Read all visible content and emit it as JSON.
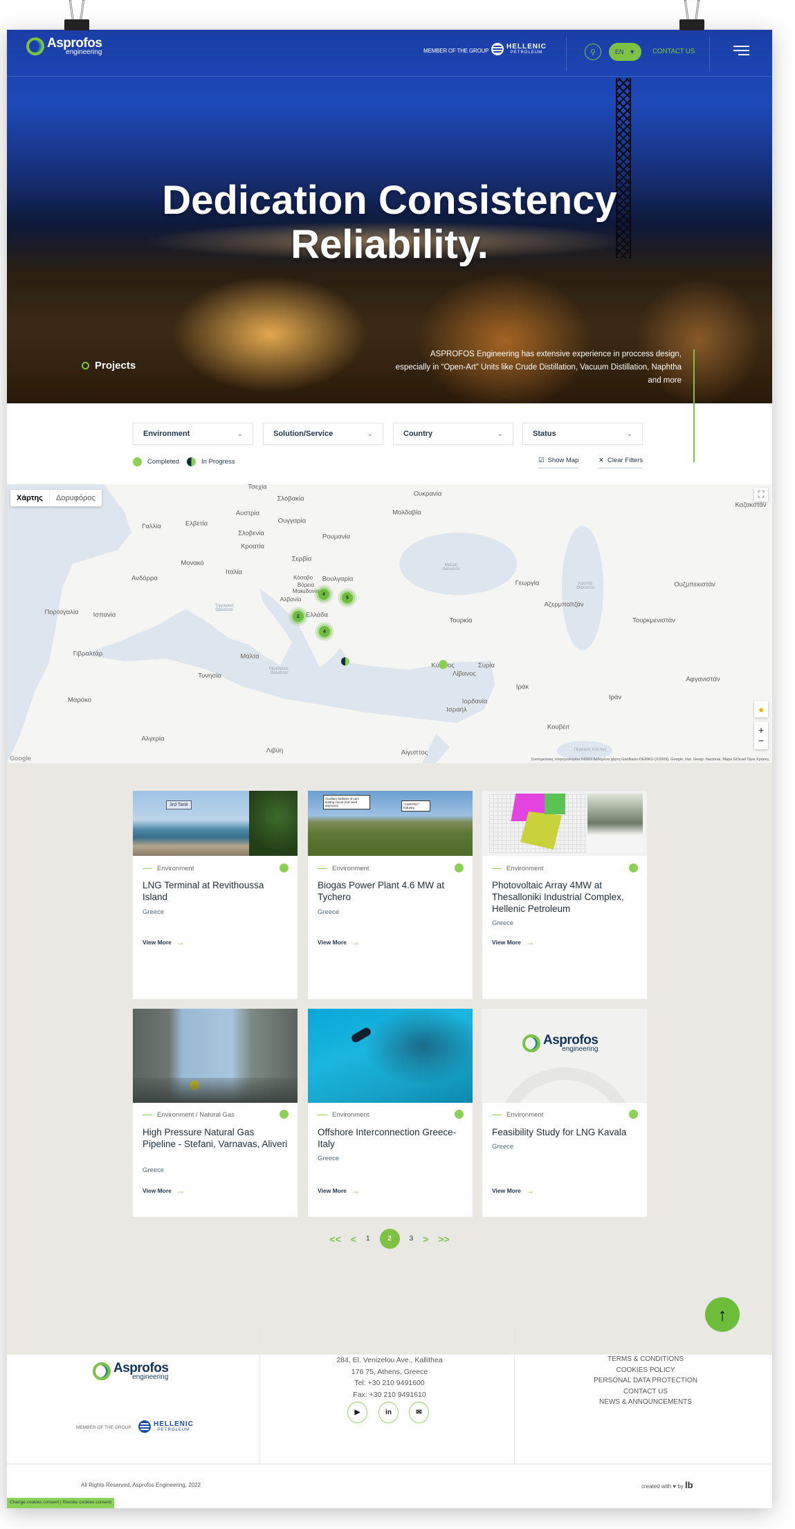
{
  "header": {
    "brand": "Asprofos",
    "brand_sub": "engineering",
    "member_label": "MEMBER OF THE GROUP",
    "partner_name": "HELLENIC",
    "partner_sub": "PETROLEUM",
    "language": "EN",
    "contact_label": "CONTACT US",
    "search_icon": "search-icon",
    "menu_icon": "hamburger-icon"
  },
  "hero": {
    "title_line1": "Dedication Consistency",
    "title_line2": "Reliability.",
    "section_label": "Projects",
    "description": "ASPROFOS Engineering has extensive experience in proccess design, especially in “Open-Art” Units like Crude Distillation, Vacuum Distillation, Naphtha and more"
  },
  "filters": {
    "selects": [
      "Environment",
      "Solution/Service",
      "Country",
      "Status"
    ],
    "legend_completed": "Completed",
    "legend_in_progress": "In Progress",
    "show_map": "Show Map",
    "show_map_checked": true,
    "clear_filters": "Clear Filters"
  },
  "map": {
    "type_map": "Χάρτης",
    "type_satellite": "Δορυφόρος",
    "active_type": "Χάρτης",
    "labels": [
      "Τσεχία",
      "Σλοβακία",
      "Αυστρία",
      "Ουγγαρία",
      "Γαλλία",
      "Ελβετία",
      "Σλοβενία",
      "Ρουμανία",
      "Κροατία",
      "Σερβία",
      "Μονακό",
      "Ιταλία",
      "Ανδόρρα",
      "Κόσοβο",
      "Βουλγαρία",
      "Βόρεια Μακεδονία",
      "Αλβανία",
      "Πορτογαλία",
      "Ισπανία",
      "Ελλάδα",
      "Γιβραλτάρ",
      "Μάλτα",
      "Τυνησία",
      "Μαρόκο",
      "Αλγερία",
      "Λιβύη",
      "Μολδαβία",
      "Ουκρανία",
      "Καζακστάν",
      "Γεωργία",
      "Αζερμπαϊτζάν",
      "Ουζμπεκιστάν",
      "Τουρκία",
      "Τουρκμενιστάν",
      "Κύπρος",
      "Συρία",
      "Λίβανος",
      "Ιράκ",
      "Αφγανιστάν",
      "Ιράν",
      "Ιορδανία",
      "Ισραήλ",
      "Κουβέιτ",
      "Αίγυπτος"
    ],
    "sea_labels": [
      "Τυρρηνική Θάλασσα",
      "Μεσόγειος Θάλασσα",
      "Μαύρη Θάλασσα",
      "Κασπία Θάλασσα",
      "Περσικός Κόλπος"
    ],
    "clusters": [
      "4",
      "5",
      "2",
      "4"
    ],
    "attribution": "Συντομεύσεις πληκτρολογίου   ©2022 Δεδομένα χάρτη GeoBasis-DE/BKG (©2009), Google, Inst. Geogr. Nacional, Mapa GISrael   Όροι Χρήσης",
    "google": "Google"
  },
  "projects": [
    {
      "category": "Environment",
      "title": "LNG Terminal at Revithoussa Island",
      "country": "Greece",
      "status": "completed",
      "link": "View More"
    },
    {
      "category": "Environment",
      "title": "Biogas Power Plant 4.6 MW at Tychero",
      "country": "Greece",
      "status": "completed",
      "link": "View More"
    },
    {
      "category": "Environment",
      "title": "Photovoltaic Array 4MW at Thesalloniki Industrial Complex, Hellenic Petroleum",
      "country": "Greece",
      "status": "completed",
      "link": "View More"
    },
    {
      "category": "Environment / Natural Gas",
      "title": "High Pressure Natural Gas Pipeline - Stefani, Varnavas, Aliveri",
      "country": "Greece",
      "status": "completed",
      "link": "View More"
    },
    {
      "category": "Environment",
      "title": "Offshore Interconnection Greece-Italy",
      "country": "Greece",
      "status": "completed",
      "link": "View More"
    },
    {
      "category": "Environment",
      "title": "Feasibility Study for LNG Kavala",
      "country": "Greece",
      "status": "completed",
      "link": "View More"
    }
  ],
  "image_texts": {
    "tank": "3rd Tank",
    "biogas_a": "Auxiliary facilities of cart testing circuit (not used anymore)",
    "biogas_b": "\"AGRITEC\" Industry"
  },
  "pagination": {
    "first": "<<",
    "prev": "<",
    "pages": [
      "1",
      "2",
      "3"
    ],
    "current": "2",
    "next": ">",
    "last": ">>"
  },
  "footer": {
    "address": [
      "284, El. Venizelou Ave., Kallithea",
      "176 75, Athens, Greece",
      "Tel: +30 210 9491600",
      "Fax: +30 210 9491610"
    ],
    "links": [
      "TERMS & CONDITIONS",
      "COOKIES POLICY",
      "PERSONAL DATA PROTECTION",
      "CONTACT US",
      "NEWS & ANNOUNCEMENTS"
    ],
    "social": [
      "youtube-icon",
      "linkedin-icon",
      "email-icon"
    ],
    "copyright": "All Rights Reserved. Asprofos Engineering, 2022",
    "created": "created with ♥ by",
    "creator_logo": "lb",
    "cookies_change": "Change cookies consent",
    "cookies_revoke": "Revoke cookies consent"
  },
  "colors": {
    "accent": "#7dc243",
    "navy": "#1d3550",
    "header_blue": "#1d49b8"
  }
}
